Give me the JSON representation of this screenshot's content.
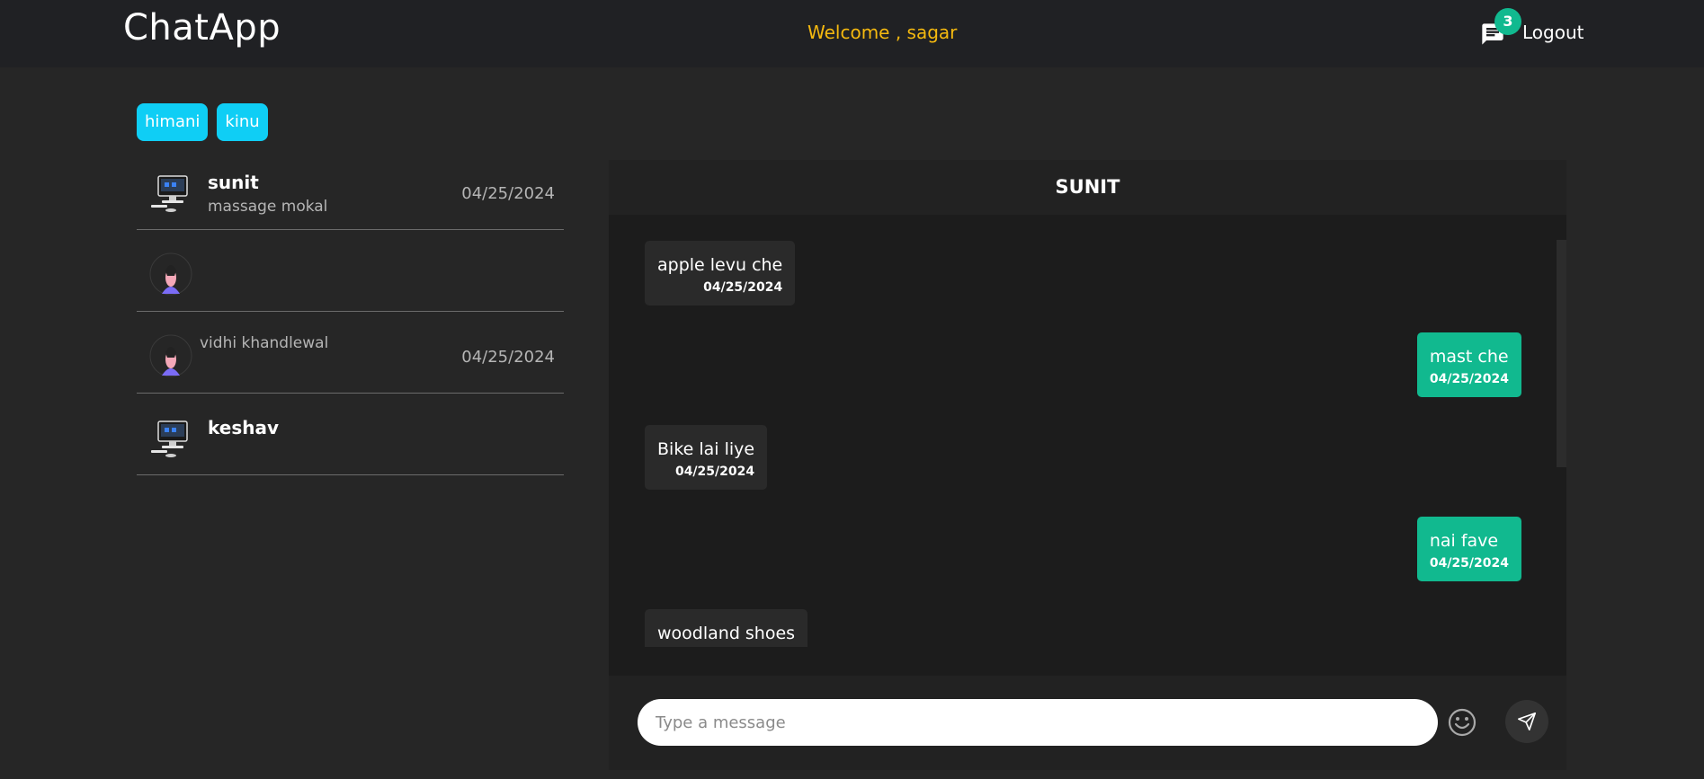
{
  "nav": {
    "brand": "ChatApp",
    "welcome": "Welcome , sagar",
    "notification_count": "3",
    "logout_label": "Logout",
    "notification_icon": "chat-bubble-icon"
  },
  "chips": [
    {
      "label": "himani"
    },
    {
      "label": "kinu"
    }
  ],
  "conversations": [
    {
      "name": "sunit",
      "preview": "massage mokal",
      "date": "04/25/2024",
      "avatar": "computer-avatar-icon"
    },
    {
      "name": "",
      "preview": "",
      "date": "",
      "avatar": "woman-avatar-icon"
    },
    {
      "name": "",
      "preview": "vidhi khandlewal",
      "date": "04/25/2024",
      "avatar": "woman-avatar-icon"
    },
    {
      "name": "keshav",
      "preview": "",
      "date": "",
      "avatar": "computer-avatar-icon"
    }
  ],
  "chat": {
    "title": "SUNIT",
    "messages": [
      {
        "text": "apple levu che",
        "time": "04/25/2024",
        "direction": "incoming"
      },
      {
        "text": "mast che",
        "time": "04/25/2024",
        "direction": "outgoing"
      },
      {
        "text": "Bike lai liye",
        "time": "04/25/2024",
        "direction": "incoming"
      },
      {
        "text": "nai fave",
        "time": "04/25/2024",
        "direction": "outgoing"
      },
      {
        "text": "woodland shoes",
        "time": "",
        "direction": "incoming"
      }
    ],
    "input_placeholder": "Type a message",
    "emoji_icon": "smiley-icon",
    "send_icon": "send-icon"
  },
  "colors": {
    "accent_green": "#11b98f",
    "chip_cyan": "#0fcef5",
    "welcome_yellow": "#f5b90f"
  }
}
